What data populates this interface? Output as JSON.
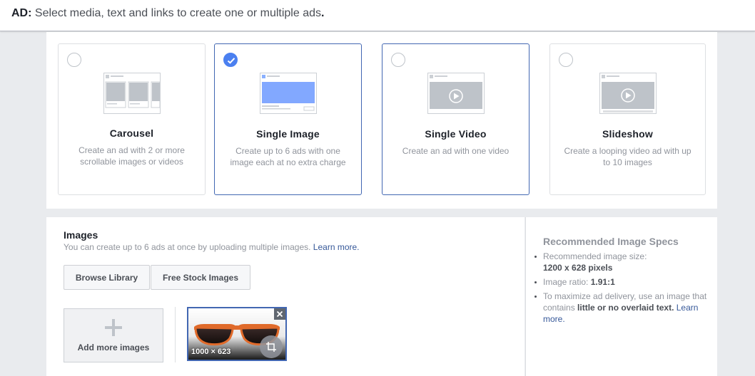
{
  "header": {
    "ad_label": "AD:",
    "instruction": "Select media, text and links to create one or multiple ads",
    "period": "."
  },
  "formats": [
    {
      "title": "Carousel",
      "desc": "Create an ad with 2 or more scrollable images or videos",
      "selected": false,
      "illustration": "carousel-illustration-icon"
    },
    {
      "title": "Single Image",
      "desc": "Create up to 6 ads with one image each at no extra charge",
      "selected": true,
      "illustration": "single-image-illustration-icon"
    },
    {
      "title": "Single Video",
      "desc": "Create an ad with one video",
      "selected": false,
      "illustration": "single-video-illustration-icon"
    },
    {
      "title": "Slideshow",
      "desc": "Create a looping video ad with up to 10 images",
      "selected": false,
      "illustration": "slideshow-illustration-icon"
    }
  ],
  "images": {
    "title": "Images",
    "help_text": "You can create up to 6 ads at once by uploading multiple images.",
    "learn_more": "Learn more.",
    "browse_library": "Browse Library",
    "free_stock_images": "Free Stock Images",
    "add_more_images": "Add more images",
    "thumbnail": {
      "dimensions": "1000 × 623",
      "subject": "orange sunglasses"
    }
  },
  "specs": {
    "title": "Recommended Image Specs",
    "size_label": "Recommended image size:",
    "size_value": "1200 x 628 pixels",
    "ratio_label": "Image ratio:",
    "ratio_value": "1.91:1",
    "delivery_prefix": "To maximize ad delivery, use an image that contains",
    "delivery_strong": "little or no overlaid text.",
    "learn_more": "Learn more."
  },
  "colors": {
    "accent": "#4267b2",
    "checked": "#4b80f0",
    "link": "#365899",
    "muted": "#90949c"
  }
}
